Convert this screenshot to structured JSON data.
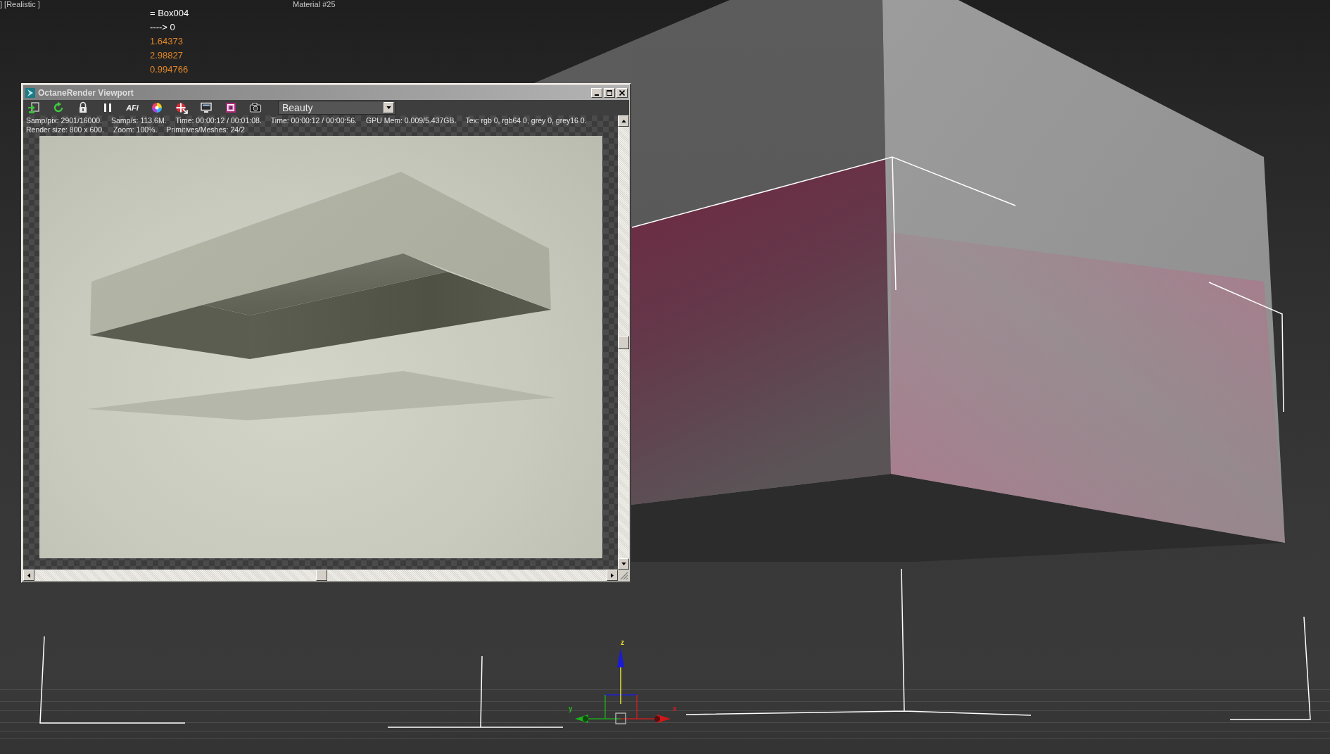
{
  "viewport": {
    "label": "] [Realistic ]",
    "material_label": "Material #25"
  },
  "info_lines": [
    {
      "text": "= Box004",
      "color": "#ffffff"
    },
    {
      "text": "----> 0",
      "color": "#ffffff"
    },
    {
      "text": "1.64373",
      "color": "#e0862a"
    },
    {
      "text": "2.98827",
      "color": "#e0862a"
    },
    {
      "text": "0.994766",
      "color": "#e0862a"
    }
  ],
  "window": {
    "title": "OctaneRender Viewport"
  },
  "toolbar": {
    "text_button": "AFi",
    "render_pass": "Beauty"
  },
  "status_lines": [
    [
      "Samp/pix: 2901/16000.",
      "Samp/s: 113.6M.",
      "Time: 00:00:12 / 00:01:08.",
      "Time: 00:00:12 / 00:00:56.",
      "GPU Mem: 0.009/5.437GB.",
      "Tex: rgb 0, rgb64 0, grey 0, grey16 0."
    ],
    [
      "Render size: 800 x 600.",
      "Zoom: 100%.",
      "Primitives/Meshes: 24/2"
    ]
  ],
  "gizmo": {
    "axis_labels": [
      {
        "text": "z",
        "kind": "z"
      },
      {
        "text": "y",
        "kind": "y"
      },
      {
        "text": "x",
        "kind": "x"
      }
    ]
  }
}
